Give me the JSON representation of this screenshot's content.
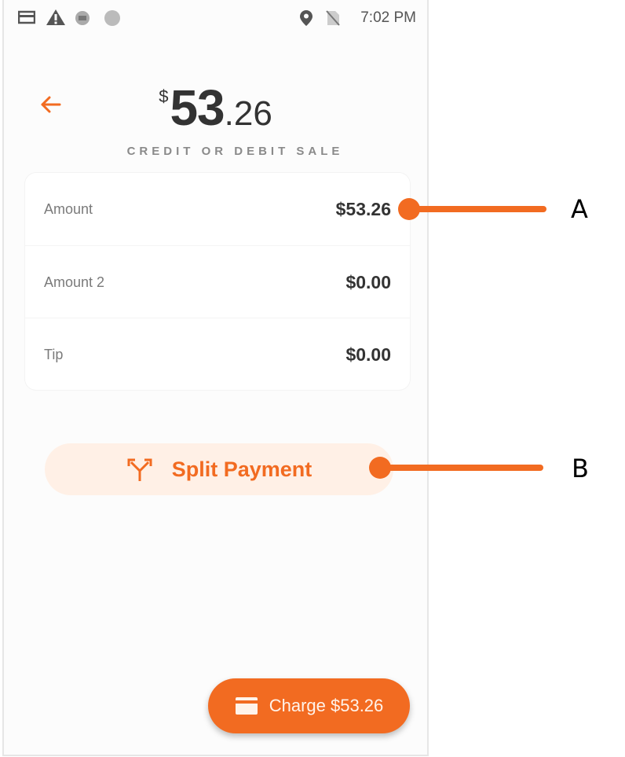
{
  "status_bar": {
    "icons": [
      "card-icon",
      "warning-icon",
      "sync-icon",
      "circle-icon",
      "location-icon",
      "no-sim-icon"
    ],
    "time": "7:02 PM"
  },
  "header": {
    "back_icon": "arrow-left-icon",
    "currency_symbol": "$",
    "amount_whole": "53",
    "amount_cents": ".26",
    "subtitle": "CREDIT OR DEBIT SALE"
  },
  "breakdown": {
    "rows": [
      {
        "label": "Amount",
        "value": "$53.26"
      },
      {
        "label": "Amount 2",
        "value": "$0.00"
      },
      {
        "label": "Tip",
        "value": "$0.00"
      }
    ]
  },
  "split_button": {
    "icon": "split-icon",
    "label": "Split Payment"
  },
  "charge_button": {
    "icon": "credit-card-icon",
    "label": "Charge $53.26"
  },
  "callouts": [
    {
      "letter": "A",
      "target": "amount-value"
    },
    {
      "letter": "B",
      "target": "split-payment-button"
    }
  ],
  "colors": {
    "accent": "#f26b21",
    "accent_light": "#fff0e6",
    "text_dark": "#333333",
    "text_muted": "#7a7a7a"
  }
}
